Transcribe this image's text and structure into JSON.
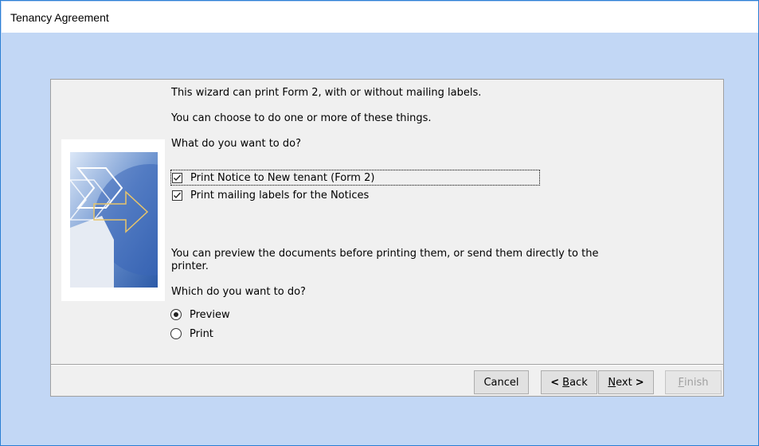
{
  "window": {
    "title": "Tenancy Agreement"
  },
  "wizard": {
    "intro_line1": "This wizard can print Form 2, with or without mailing labels.",
    "intro_line2": "You can choose to do one or more of these things.",
    "question1": "What do you want to do?",
    "options": [
      {
        "label": "Print Notice to New tenant (Form 2)",
        "checked": true
      },
      {
        "label": "Print mailing labels for the Notices",
        "checked": true
      }
    ],
    "preview_text": "You can preview the documents before printing them, or send them directly to the printer.",
    "question2": "Which do you want to do?",
    "output_modes": [
      {
        "label": "Preview",
        "selected": true
      },
      {
        "label": "Print",
        "selected": false
      }
    ]
  },
  "buttons": {
    "cancel": "Cancel",
    "back_arrow": "<",
    "back_mnemonic": "B",
    "back_rest": "ack",
    "next_mnemonic": "N",
    "next_rest": "ext",
    "next_arrow": ">",
    "finish_mnemonic": "F",
    "finish_rest": "inish"
  },
  "colors": {
    "desktop_background": "#c2d7f5",
    "window_border": "#2a7fd4",
    "dialog_background": "#f0f0f0"
  }
}
